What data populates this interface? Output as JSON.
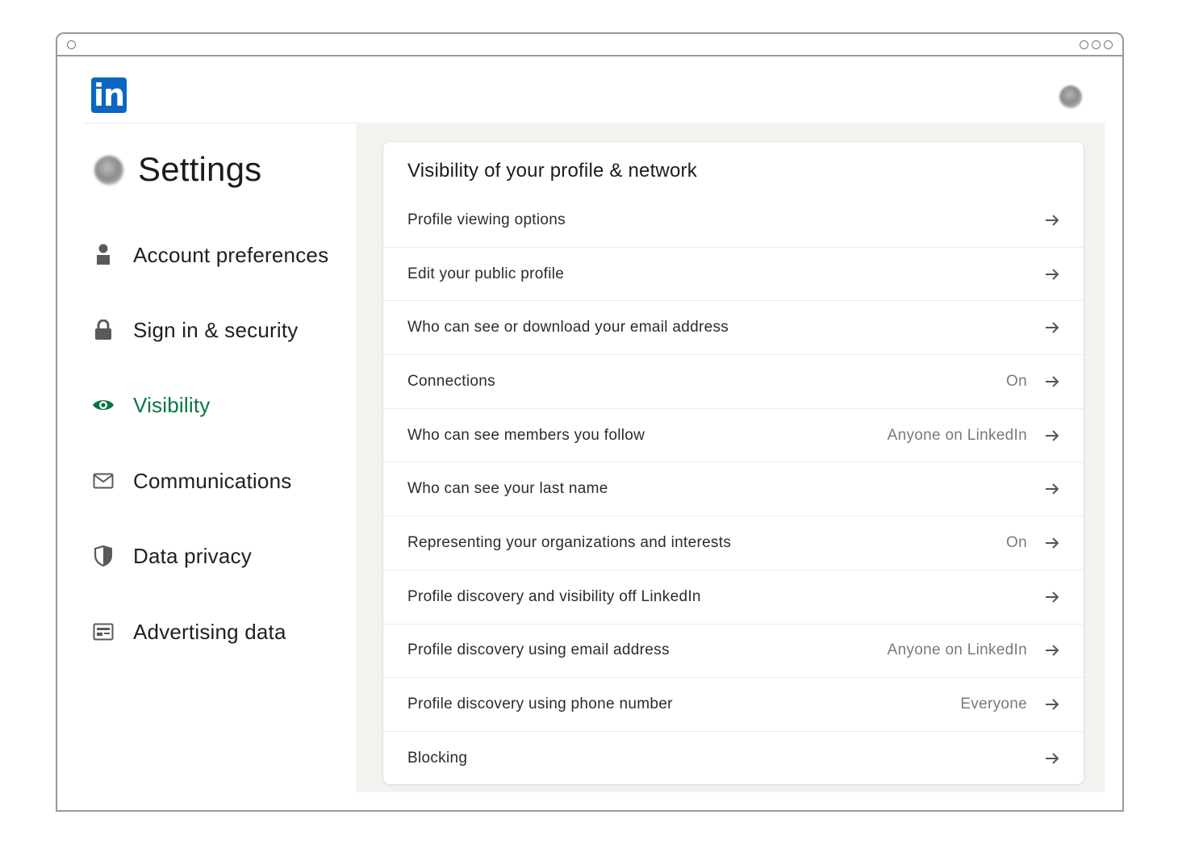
{
  "window": {
    "controls": [
      "minimize",
      "maximize",
      "close"
    ]
  },
  "header": {
    "logo_text": "in",
    "logo_color": "#0a66c2"
  },
  "sidebar": {
    "title": "Settings",
    "active_color": "#057642",
    "items": [
      {
        "label": "Account preferences",
        "icon": "person-icon",
        "active": false
      },
      {
        "label": "Sign in & security",
        "icon": "lock-icon",
        "active": false
      },
      {
        "label": "Visibility",
        "icon": "eye-icon",
        "active": true
      },
      {
        "label": "Communications",
        "icon": "envelope-icon",
        "active": false
      },
      {
        "label": "Data privacy",
        "icon": "shield-icon",
        "active": false
      },
      {
        "label": "Advertising data",
        "icon": "ad-card-icon",
        "active": false
      }
    ]
  },
  "main": {
    "title": "Visibility of your profile & network",
    "rows": [
      {
        "label": "Profile viewing options",
        "value": ""
      },
      {
        "label": "Edit your public profile",
        "value": ""
      },
      {
        "label": "Who can see or download your email address",
        "value": ""
      },
      {
        "label": "Connections",
        "value": "On"
      },
      {
        "label": "Who can see members you follow",
        "value": "Anyone on LinkedIn"
      },
      {
        "label": "Who can see your last name",
        "value": ""
      },
      {
        "label": "Representing your organizations and interests",
        "value": "On"
      },
      {
        "label": "Profile discovery and visibility off LinkedIn",
        "value": ""
      },
      {
        "label": "Profile discovery using email address",
        "value": "Anyone on LinkedIn"
      },
      {
        "label": "Profile discovery using phone number",
        "value": "Everyone"
      },
      {
        "label": "Blocking",
        "value": ""
      }
    ]
  }
}
